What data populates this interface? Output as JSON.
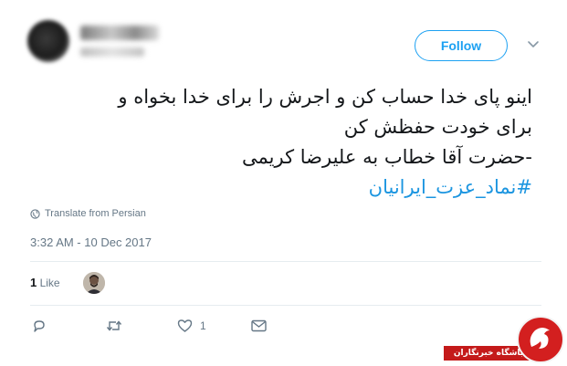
{
  "header": {
    "follow_label": "Follow"
  },
  "tweet": {
    "lines": [
      "اینو پای خدا حساب کن و اجرش را برای خدا بخواه و",
      "برای خودت حفظش کن",
      "-حضرت آقا خطاب به علیرضا کریمی"
    ],
    "hashtag": "#نماد_عزت_ایرانیان"
  },
  "meta": {
    "translate_label": "Translate from Persian",
    "timestamp": "3:32 AM - 10 Dec 2017"
  },
  "stats": {
    "likes_count": "1",
    "likes_label": "Like"
  },
  "actions": {
    "reply_icon": "reply-icon",
    "retweet_icon": "retweet-icon",
    "like_icon": "heart-icon",
    "like_count": "1",
    "message_icon": "envelope-icon"
  },
  "watermark": {
    "text": "باشگاه خبرنگاران"
  },
  "colors": {
    "accent": "#1da1f2",
    "hashtag": "#1b95e0",
    "muted": "#657786",
    "divider": "#e6ecf0",
    "watermark_red": "#c41a1a"
  }
}
